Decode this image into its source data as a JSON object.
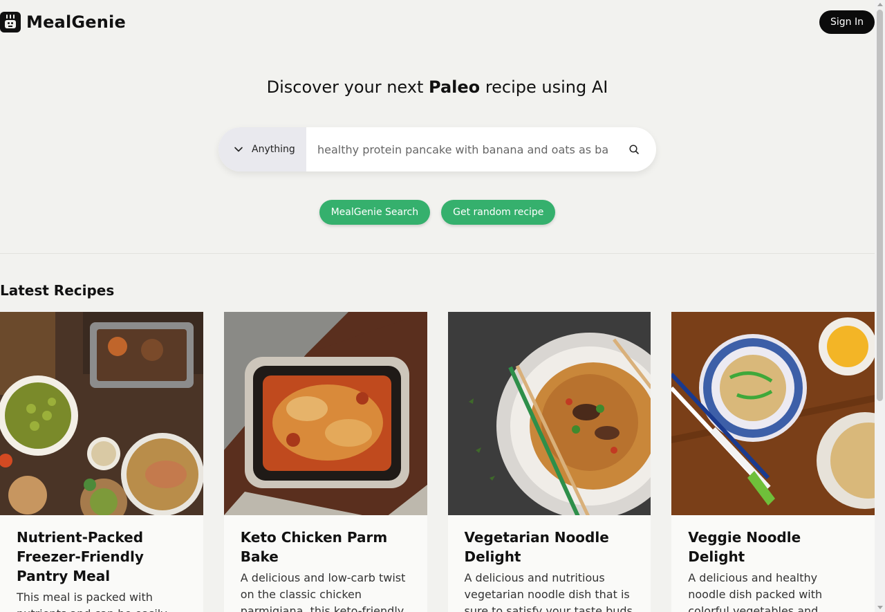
{
  "header": {
    "brand_name": "MealGenie",
    "sign_in_label": "Sign In"
  },
  "hero": {
    "title_prefix": "Discover your next",
    "title_highlight": "Paleo",
    "title_suffix": "recipe using AI"
  },
  "search": {
    "category_selected": "Anything",
    "query_value": "healthy protein pancake with banana and oats as ba",
    "placeholder": "healthy protein pancake with banana and oats as ba"
  },
  "actions": {
    "search_label": "MealGenie Search",
    "random_label": "Get random recipe"
  },
  "latest": {
    "title": "Latest Recipes",
    "recipes": [
      {
        "title": "Nutrient-Packed Freezer-Friendly Pantry Meal",
        "description": "This meal is packed with nutrients and can be easily frozen"
      },
      {
        "title": "Keto Chicken Parm Bake",
        "description": "A delicious and low-carb twist on the classic chicken parmigiana, this keto-friendly bake"
      },
      {
        "title": "Vegetarian Noodle Delight",
        "description": "A delicious and nutritious vegetarian noodle dish that is sure to satisfy your taste buds"
      },
      {
        "title": "Veggie Noodle Delight",
        "description": "A delicious and healthy noodle dish packed with colorful vegetables and"
      }
    ]
  },
  "colors": {
    "accent": "#35b06d",
    "background": "#f2f2ef",
    "dark": "#0b0b0b"
  }
}
